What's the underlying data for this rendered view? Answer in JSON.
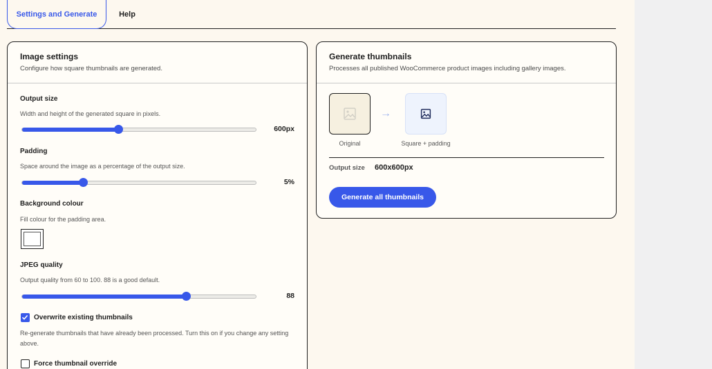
{
  "tabs": [
    {
      "label": "Settings and Generate",
      "active": true
    },
    {
      "label": "Help",
      "active": false
    }
  ],
  "image_settings": {
    "title": "Image settings",
    "subtitle": "Configure how square thumbnails are generated.",
    "output_size": {
      "label": "Output size",
      "help": "Width and height of the generated square in pixels.",
      "value_text": "600px",
      "fraction": 0.41
    },
    "padding": {
      "label": "Padding",
      "help": "Space around the image as a percentage of the output size.",
      "value_text": "5%",
      "fraction": 0.26
    },
    "background_colour": {
      "label": "Background colour",
      "help": "Fill colour for the padding area.",
      "color": "#ffffff"
    },
    "jpeg_quality": {
      "label": "JPEG quality",
      "help": "Output quality from 60 to 100. 88 is a good default.",
      "value_text": "88",
      "fraction": 0.7
    },
    "overwrite": {
      "label": "Overwrite existing thumbnails",
      "checked": true,
      "help": "Re-generate thumbnails that have already been processed. Turn this on if you change any setting above."
    },
    "force_override": {
      "label": "Force thumbnail override",
      "checked": false
    }
  },
  "generate": {
    "title": "Generate thumbnails",
    "subtitle": "Processes all published WooCommerce product images including gallery images.",
    "preview_original_caption": "Original",
    "preview_square_caption": "Square + padding",
    "output_size_label": "Output size",
    "output_size_value": "600x600px",
    "button_label": "Generate all thumbnails"
  },
  "colors": {
    "accent": "#3858e9",
    "page_bg": "#fdf8ef",
    "side_bg": "#f0f0f1"
  },
  "icons": {
    "original": "image-icon",
    "square": "image-icon",
    "arrow": "arrow-right-icon",
    "check": "checkmark-icon"
  }
}
